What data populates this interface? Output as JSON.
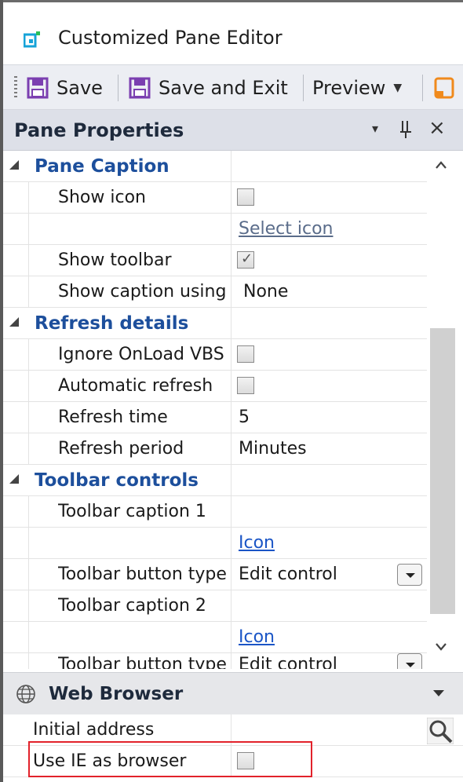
{
  "window": {
    "title": "Customized Pane Editor"
  },
  "toolbar": {
    "save_label": "Save",
    "save_exit_label": "Save and Exit",
    "preview_label": "Preview"
  },
  "pane": {
    "title": "Pane Properties",
    "pin_glyph": "↑",
    "close_glyph": "×",
    "menu_glyph": "▾"
  },
  "sections": [
    {
      "label": "Pane Caption",
      "rows": [
        {
          "name": "Show icon",
          "type": "checkbox",
          "checked": false
        },
        {
          "name": "",
          "type": "link",
          "value": "Select icon"
        },
        {
          "name": "Show toolbar",
          "type": "checkbox",
          "checked": true
        },
        {
          "name": "Show caption using",
          "type": "text",
          "value": "None"
        }
      ]
    },
    {
      "label": "Refresh details",
      "rows": [
        {
          "name": "Ignore OnLoad VBS",
          "type": "checkbox",
          "checked": false
        },
        {
          "name": "Automatic refresh",
          "type": "checkbox",
          "checked": false
        },
        {
          "name": "Refresh time",
          "type": "text",
          "value": "5"
        },
        {
          "name": "Refresh period",
          "type": "text",
          "value": "Minutes"
        }
      ]
    },
    {
      "label": "Toolbar controls",
      "rows": [
        {
          "name": "Toolbar caption 1",
          "type": "text",
          "value": ""
        },
        {
          "name": "",
          "type": "link",
          "value": "Icon"
        },
        {
          "name": "Toolbar button type",
          "type": "dropdown",
          "value": "Edit control"
        },
        {
          "name": "Toolbar caption 2",
          "type": "text",
          "value": ""
        },
        {
          "name": "",
          "type": "link",
          "value": "Icon"
        },
        {
          "name": "Toolbar button type",
          "type": "dropdown",
          "value": "Edit control"
        }
      ]
    }
  ],
  "scrollbar": {
    "up_glyph": "⌃",
    "down_glyph": "⌄"
  },
  "web_browser": {
    "title": "Web Browser",
    "rows": [
      {
        "name": "Initial address",
        "type": "text",
        "value": ""
      },
      {
        "name": "Use IE as browser",
        "type": "checkbox",
        "checked": false
      }
    ]
  },
  "colors": {
    "category_text": "#1d4f9c",
    "link_blue": "#1a55c6",
    "highlight_red": "#e2222b",
    "save_icon": "#7b3fb0"
  },
  "icons": {
    "app": "pane-editor-icon",
    "save": "floppy-disk-icon",
    "preview_extra": "orange-document-icon",
    "globe": "globe-icon",
    "search": "magnifier-icon"
  }
}
